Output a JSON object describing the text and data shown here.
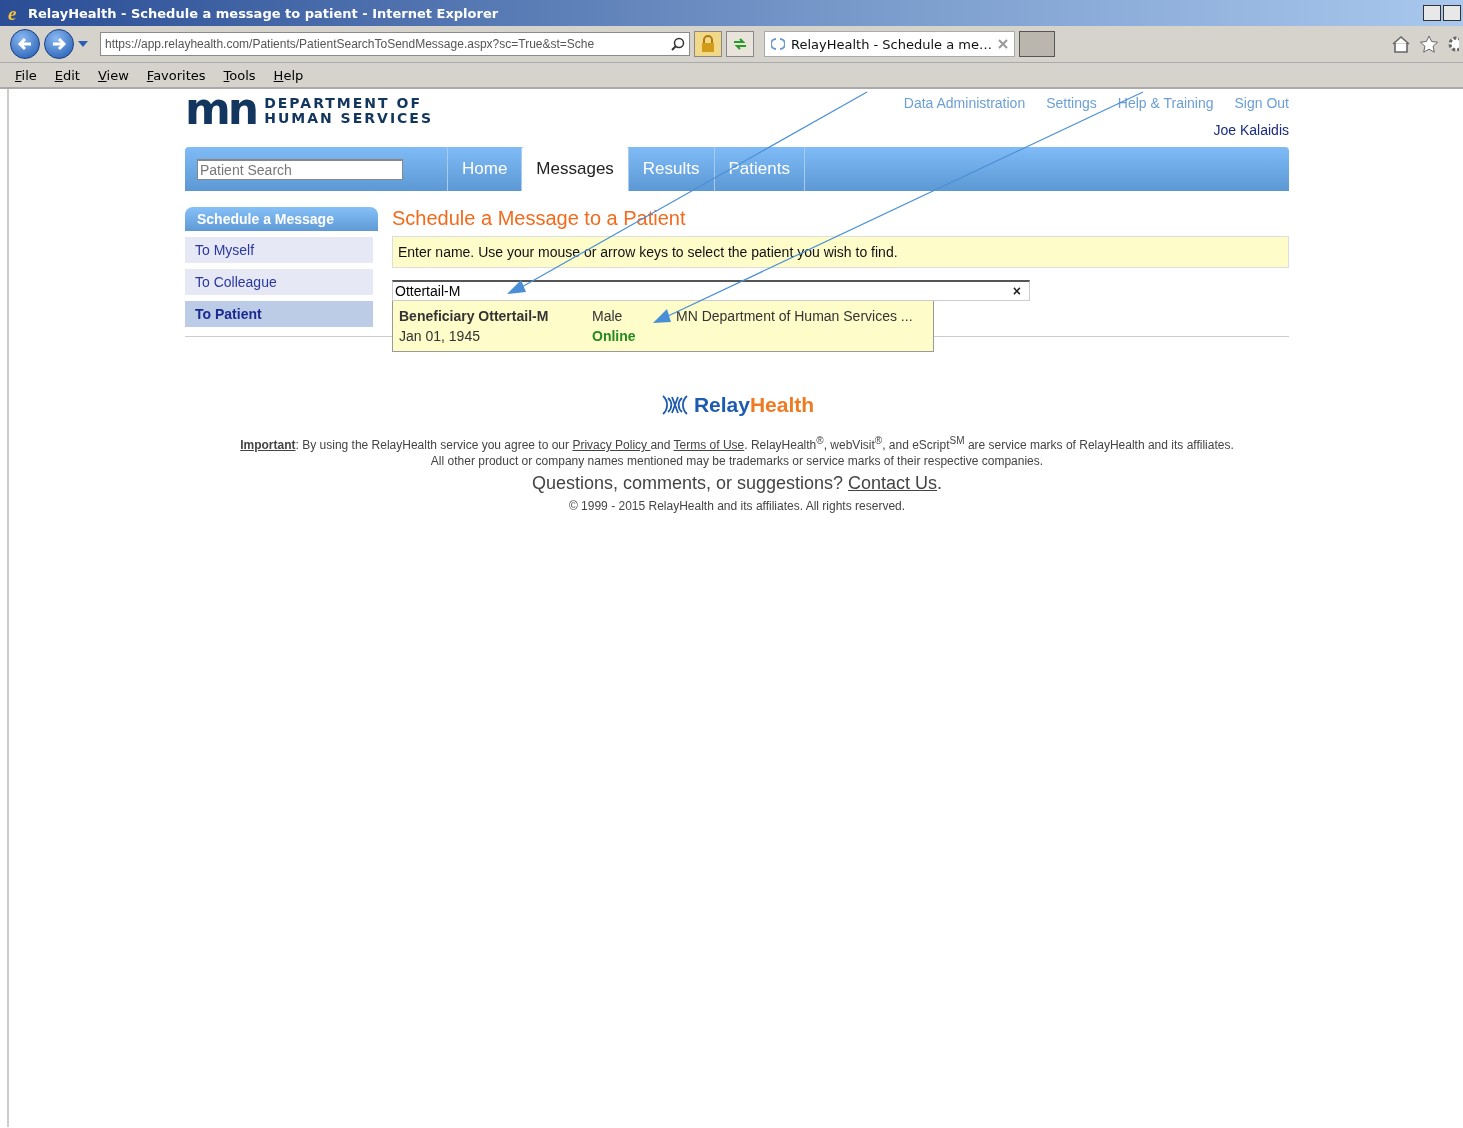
{
  "window": {
    "browser_logo": "e",
    "title": "RelayHealth - Schedule a message to patient - Internet Explorer"
  },
  "address_bar": {
    "url": "https://app.relayhealth.com/Patients/PatientSearchToSendMessage.aspx?sc=True&st=Sche"
  },
  "browser_tabs": [
    {
      "label": "RelayHealth - Schedule a me…",
      "selected": true
    }
  ],
  "menu_bar": [
    "File",
    "Edit",
    "View",
    "Favorites",
    "Tools",
    "Help"
  ],
  "header": {
    "logo_mark": "mn",
    "logo_line_1": "DEPARTMENT OF",
    "logo_line_2": "HUMAN SERVICES",
    "links": [
      "Data Administration",
      "Settings",
      "Help & Training",
      "Sign Out"
    ],
    "user": "Joe Kalaidis"
  },
  "nav": {
    "search": {
      "placeholder": "Patient Search"
    },
    "tabs": [
      {
        "label": "Home",
        "selected": false
      },
      {
        "label": "Messages",
        "selected": true
      },
      {
        "label": "Results",
        "selected": false
      },
      {
        "label": "Patients",
        "selected": false
      }
    ]
  },
  "sidebar": {
    "title": "Schedule a Message",
    "items": [
      {
        "label": "To Myself",
        "selected": false
      },
      {
        "label": "To Colleague",
        "selected": false
      },
      {
        "label": "To Patient",
        "selected": true
      }
    ]
  },
  "main": {
    "title": "Schedule a Message to a Patient",
    "hint": "Enter name. Use your mouse or arrow keys to select the patient you wish to find.",
    "search_value": "Ottertail-M",
    "clear": "×",
    "results": [
      {
        "name": "Beneficiary Ottertail-M",
        "dob": "Jan 01, 1945",
        "gender": "Male",
        "status": "Online",
        "organization": "MN Department of Human Services ..."
      }
    ]
  },
  "footer": {
    "logo_part_1": "Relay",
    "logo_part_2": "Health",
    "notice": [
      {
        "kind": "strong-link",
        "text": "Important"
      },
      {
        "kind": "text",
        "text": ": By using the RelayHealth service you agree to our "
      },
      {
        "kind": "link",
        "text": "Privacy Policy "
      },
      {
        "kind": "text",
        "text": "and "
      },
      {
        "kind": "link",
        "text": "Terms of Use"
      },
      {
        "kind": "text",
        "text": ". RelayHealth$^{®}$, webVisit$^{®}$, and eScript$^{SM}$ are service marks of RelayHealth and its affiliates. All other product or company names mentioned may be trademarks or service marks of their respective companies."
      }
    ],
    "questions": "Questions, comments, or suggestions?",
    "contact": "Contact Us",
    "contact_end": ".",
    "copyright": "© 1999 - 2015 RelayHealth and its affiliates. All rights reserved."
  }
}
